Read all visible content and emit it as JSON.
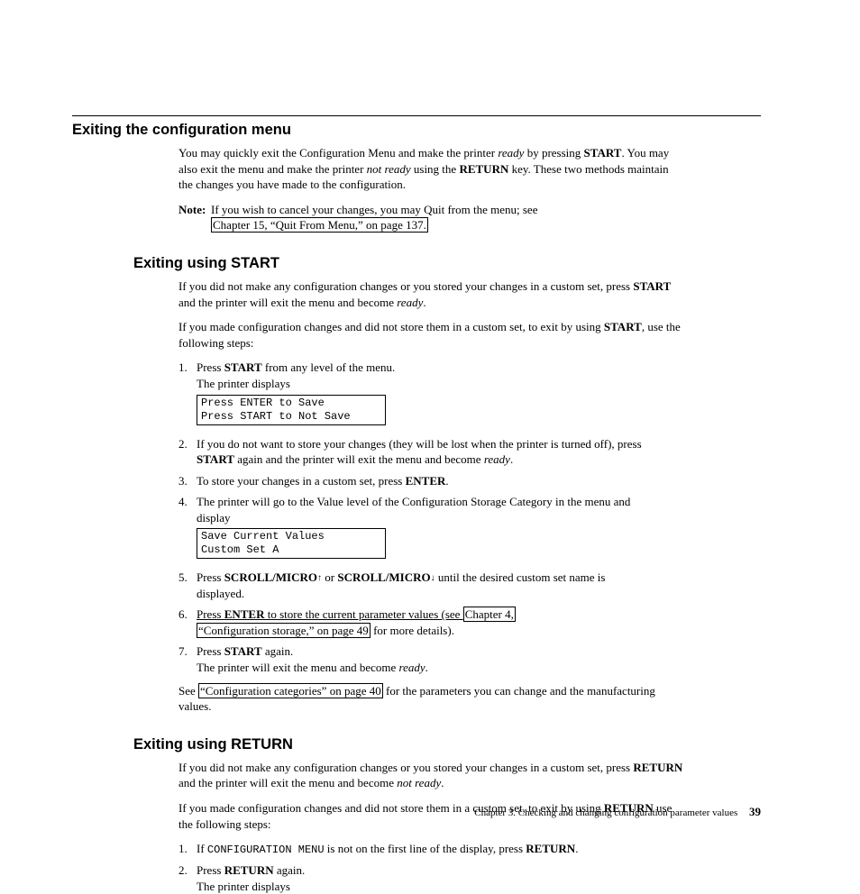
{
  "h1": "Exiting the configuration menu",
  "intro": {
    "pre1": "You may quickly exit the Configuration Menu and make the printer ",
    "ready": "ready",
    "pre2": " by pressing ",
    "start": "START",
    "pre3": ". You may also exit the menu and make the printer ",
    "notready": "not ready",
    "pre4": " using the ",
    "return": "RETURN",
    "pre5": " key. These two methods maintain the changes you have made to the configuration."
  },
  "note": {
    "label": "Note:",
    "text1": "If you wish to cancel your changes, you may Quit from the menu; see ",
    "ref": "Chapter 15, “Quit From Menu,” on page 137."
  },
  "h2a": "Exiting using START",
  "startSec": {
    "p1a": "If you did not make any configuration changes or you stored your changes in a custom set, press ",
    "p1b": "START",
    "p1c": " and the printer will exit the menu and become ",
    "p1d": "ready",
    "p1e": ".",
    "p2a": "If you made configuration changes and did not store them in a custom set, to exit by using ",
    "p2b": "START",
    "p2c": ", use the following steps:",
    "steps": {
      "n1": "1.",
      "s1a": "Press ",
      "s1b": "START",
      "s1c": " from any level of the menu.",
      "s1d": "The printer displays",
      "box1": "Press ENTER to Save\nPress START to Not Save",
      "n2": "2.",
      "s2a": "If you do not want to store your changes (they will be lost when the printer is turned off), press ",
      "s2b": "START",
      "s2c": " again and the printer will exit the menu and become ",
      "s2d": "ready",
      "s2e": ".",
      "n3": "3.",
      "s3a": "To store your changes in a custom set, press ",
      "s3b": "ENTER",
      "s3c": ".",
      "n4": "4.",
      "s4a": "The printer will go to the Value level of the Configuration Storage Category in the menu and display",
      "box2": "Save Current Values\nCustom Set A",
      "n5": "5.",
      "s5a": "Press ",
      "s5b": "SCROLL/MICRO",
      "s5c": " or ",
      "s5d": "SCROLL/MICRO",
      "s5e": " until the desired custom set name is displayed.",
      "n6": "6.",
      "s6a": "Press ",
      "s6b": "ENTER",
      "s6c": " to store the current parameter values (see ",
      "s6ref1": "Chapter 4,",
      "s6ref2": "“Configuration storage,” on page 49",
      "s6d": " for more details).",
      "n7": "7.",
      "s7a": "Press ",
      "s7b": "START",
      "s7c": " again.",
      "s7d": "The printer will exit the menu and become ",
      "s7e": "ready",
      "s7f": "."
    },
    "p3a": "See ",
    "p3ref": "“Configuration categories” on page 40",
    "p3b": " for the parameters you can change and the manufacturing values."
  },
  "h2b": "Exiting using RETURN",
  "returnSec": {
    "p1a": "If you did not make any configuration changes or you stored your changes in a custom set, press ",
    "p1b": "RETURN",
    "p1c": " and the printer will exit the menu and become ",
    "p1d": "not ready",
    "p1e": ".",
    "p2a": "If you made configuration changes and did not store them in a custom set, to exit by using ",
    "p2b": "RETURN",
    "p2c": " use the following steps:",
    "steps": {
      "n1": "1.",
      "s1a": "If ",
      "s1mono": "CONFIGURATION MENU",
      "s1b": " is not on the first line of the display, press ",
      "s1c": "RETURN",
      "s1d": ".",
      "n2": "2.",
      "s2a": "Press ",
      "s2b": "RETURN",
      "s2c": " again.",
      "s2d": "The printer displays"
    }
  },
  "footer": {
    "text": "Chapter 3. Checking and changing configuration parameter values",
    "page": "39"
  }
}
